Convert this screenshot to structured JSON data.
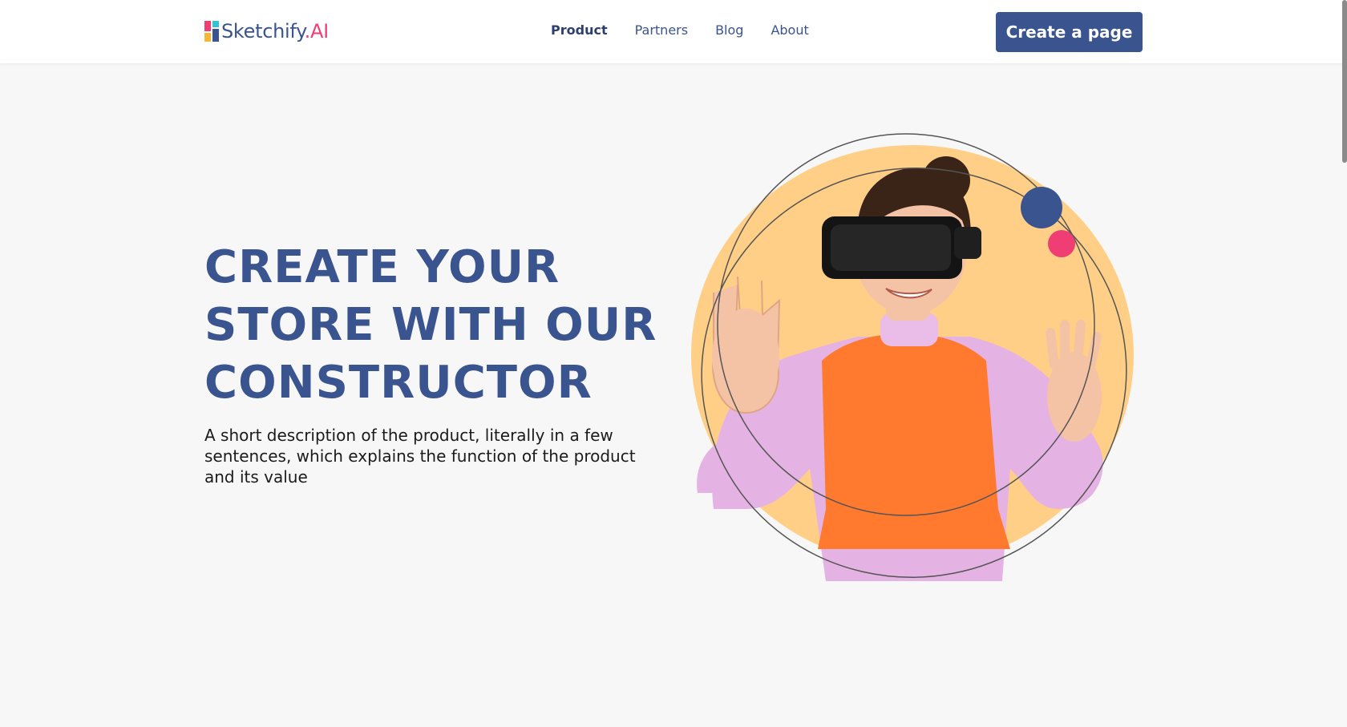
{
  "header": {
    "logo": {
      "text_main": "Sketchify",
      "text_dot_ai": ".AI"
    },
    "nav": [
      {
        "label": "Product",
        "active": true
      },
      {
        "label": "Partners",
        "active": false
      },
      {
        "label": "Blog",
        "active": false
      },
      {
        "label": "About",
        "active": false
      }
    ],
    "cta_label": "Create a page"
  },
  "hero": {
    "title": "CREATE YOUR STORE WITH OUR CONSTRUCTOR",
    "description": "A short description of the product, literally in a few sentences, which explains the function of the product and its value"
  },
  "colors": {
    "brand_blue": "#3a5490",
    "accent_pink": "#f03e74",
    "accent_peach": "#ffcf87",
    "background": "#f7f7f7"
  }
}
